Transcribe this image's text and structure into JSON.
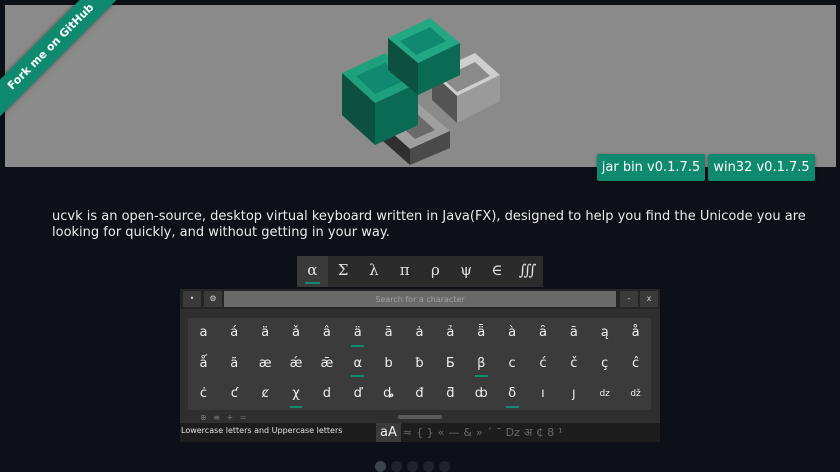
{
  "ribbon": {
    "label": "Fork me on GitHub"
  },
  "downloads": {
    "jar": "jar bin v0.1.7.5",
    "win32": "win32 v0.1.7.5"
  },
  "description": "ucvk is an open-source, desktop virtual keyboard written in Java(FX), designed to help you find the Unicode you are looking for quickly, and without getting in your way.",
  "categories": [
    "α",
    "Σ",
    "λ",
    "π",
    "ρ",
    "ψ",
    "∈",
    "∭"
  ],
  "toolbar": {
    "pin": "•",
    "settings": "⚙",
    "search_placeholder": "Search for a character",
    "minimize": "-",
    "close": "x"
  },
  "keys": [
    [
      "a",
      "á",
      "ä",
      "ǎ",
      "â",
      "ä",
      "ā",
      "ȧ",
      "ả",
      "ǟ",
      "à",
      "ȃ",
      "ā",
      "ą",
      "å"
    ],
    [
      "ǻ",
      "ã",
      "æ",
      "ǽ",
      "ǣ",
      "α",
      "b",
      "ƀ",
      "Ƃ",
      "β",
      "c",
      "ć",
      "č",
      "ç",
      "ĉ"
    ],
    [
      "ċ",
      "ƈ",
      "ȼ",
      "χ",
      "d",
      "ď",
      "ȡ",
      "đ",
      "ƌ",
      "ȸ",
      "δ",
      "ı",
      "ȷ",
      "dz",
      "dž"
    ]
  ],
  "marked_keys": [
    "0-5",
    "1-5",
    "1-9",
    "2-3",
    "2-10"
  ],
  "bottom_tools": "⊕ ≡ + =",
  "status": {
    "label": "Lowercase letters and Uppercase letters"
  },
  "groups": [
    "aA",
    "≈",
    "{ }",
    "«",
    "—",
    "&",
    "»",
    "ˊ",
    "¯",
    "Dz",
    "अ",
    "₵",
    "8",
    "¹"
  ],
  "active_group": 0,
  "pager": {
    "count": 5,
    "active": 0
  },
  "colors": {
    "accent": "#0f8a6e",
    "background": "#0d1117",
    "hero": "#8a8a8a"
  }
}
